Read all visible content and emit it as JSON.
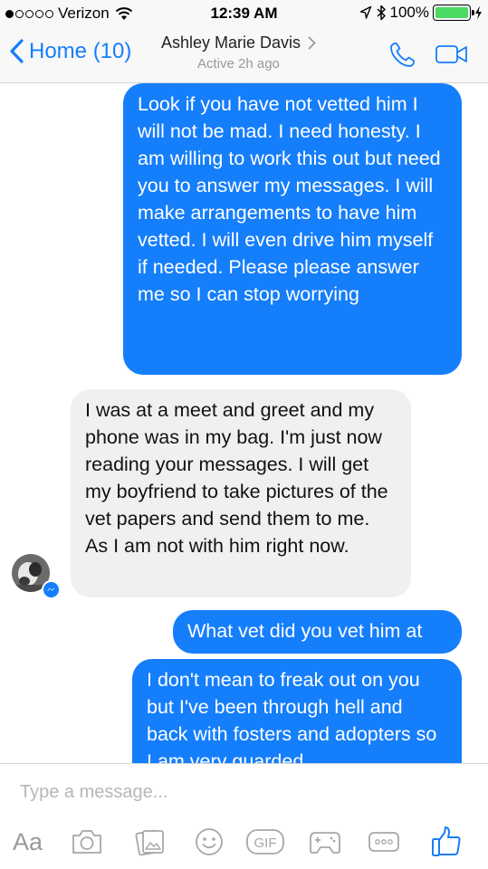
{
  "status_bar": {
    "carrier": "Verizon",
    "time": "12:39 AM",
    "battery": "100%"
  },
  "nav": {
    "back_label": "Home (10)",
    "contact_name": "Ashley Marie Davis",
    "presence": "Active 2h ago"
  },
  "messages": [
    {
      "direction": "outgoing",
      "text": "Look if you have not vetted him I will not be mad. I need honesty. I am willing to work this out but need you to answer my messages. I will make arrangements to have him vetted. I will even drive him myself if needed. Please please answer me so I can stop worrying"
    },
    {
      "direction": "incoming",
      "text": "I was at a meet and greet and my phone was in my bag. I'm just now reading your messages. I will get my boyfriend to take pictures of the vet papers and send them to me. As I am not with him right now."
    },
    {
      "direction": "outgoing",
      "text": "What vet did you vet him at"
    },
    {
      "direction": "outgoing",
      "text": "I don't mean to freak out on you but I've been through hell and back with fosters and adopters so I am very guarded"
    }
  ],
  "composer": {
    "placeholder": "Type a message...",
    "text_format_label": "Aa",
    "gif_label": "GIF"
  },
  "colors": {
    "accent": "#157efb",
    "outgoing_bubble": "#157efb",
    "incoming_bubble": "#f0f0f0",
    "battery": "#4cd964"
  },
  "icons": [
    "wifi-icon",
    "location-arrow-icon",
    "bluetooth-icon",
    "battery-icon",
    "back-chevron-icon",
    "chevron-right-icon",
    "phone-icon",
    "video-camera-icon",
    "camera-icon",
    "photo-gallery-icon",
    "emoji-icon",
    "gif-icon",
    "game-controller-icon",
    "more-icon",
    "thumbs-up-icon",
    "messenger-badge-icon"
  ]
}
